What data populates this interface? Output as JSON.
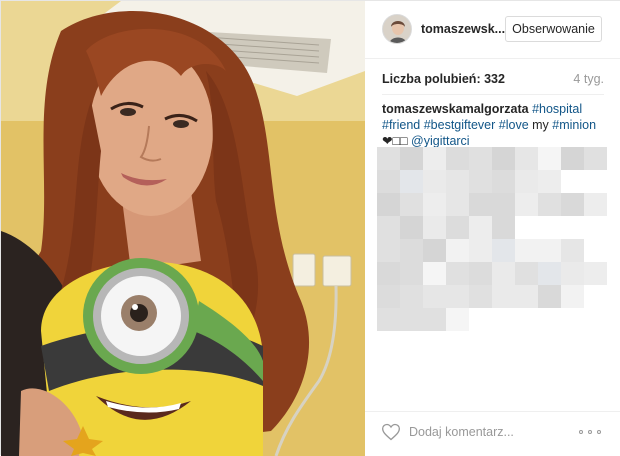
{
  "post": {
    "photo_icon": "selfie-with-minion-photo",
    "author": {
      "username": "tomaszewsk...",
      "avatar_icon": "profile-avatar"
    },
    "follow_label": "Obserwowanie",
    "likes_text": "Liczba polubień: 332",
    "time_ago": "4 tyg.",
    "caption": {
      "author": "tomaszewskamalgorzata",
      "segments": [
        {
          "text": " ",
          "tag": false
        },
        {
          "text": "#hospital",
          "tag": true
        },
        {
          "text": " ",
          "tag": false
        },
        {
          "text": "#friend",
          "tag": true
        },
        {
          "text": " ",
          "tag": false
        },
        {
          "text": "#bestgiftever",
          "tag": true
        },
        {
          "text": " ",
          "tag": false
        },
        {
          "text": "#love",
          "tag": true
        },
        {
          "text": " my ",
          "tag": false
        },
        {
          "text": "#minion",
          "tag": true
        },
        {
          "text": " ❤□□ ",
          "tag": false
        },
        {
          "text": "@yigittarci",
          "tag": true
        }
      ]
    },
    "blurred_comments_icon": "pixelated-comments",
    "comment_placeholder": "Dodaj komentarz...",
    "like_icon": "heart-icon",
    "more_icon": "more-options-icon"
  },
  "colors": {
    "link": "#125688",
    "muted": "#999999",
    "border": "#dbdbdb"
  }
}
